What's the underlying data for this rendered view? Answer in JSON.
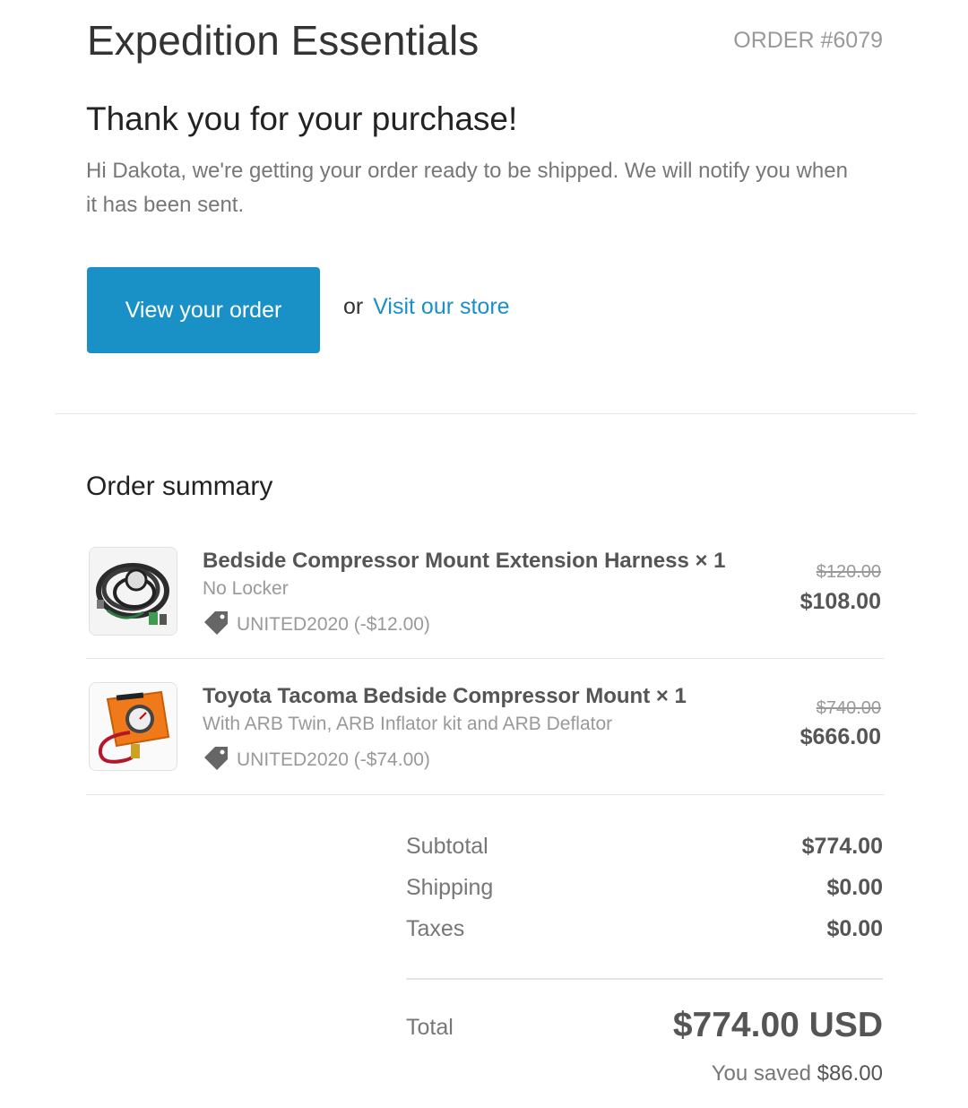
{
  "header": {
    "store_name": "Expedition Essentials",
    "order_number": "ORDER #6079"
  },
  "intro": {
    "heading": "Thank you for your purchase!",
    "message": "Hi Dakota, we're getting your order ready to be shipped. We will notify you when it has been sent."
  },
  "actions": {
    "view_order_label": "View your order",
    "or_text": "or",
    "visit_store_label": "Visit our store"
  },
  "summary": {
    "title": "Order summary",
    "items": [
      {
        "title": "Bedside Compressor Mount Extension Harness × 1",
        "variant": "No Locker",
        "discount": "UNITED2020 (-$12.00)",
        "original_price": "$120.00",
        "price": "$108.00",
        "icon": "wiring-harness-image"
      },
      {
        "title": "Toyota Tacoma Bedside Compressor Mount × 1",
        "variant": "With ARB Twin, ARB Inflator kit and ARB Deflator",
        "discount": "UNITED2020 (-$74.00)",
        "original_price": "$740.00",
        "price": "$666.00",
        "icon": "inflator-kit-image"
      }
    ]
  },
  "totals": {
    "subtotal_label": "Subtotal",
    "subtotal_value": "$774.00",
    "shipping_label": "Shipping",
    "shipping_value": "$0.00",
    "taxes_label": "Taxes",
    "taxes_value": "$0.00",
    "total_label": "Total",
    "total_value": "$774.00 USD",
    "saved_label": "You saved",
    "saved_value": "$86.00"
  },
  "colors": {
    "accent": "#1990c6",
    "text_dark": "#333333",
    "text_muted": "#777777"
  }
}
